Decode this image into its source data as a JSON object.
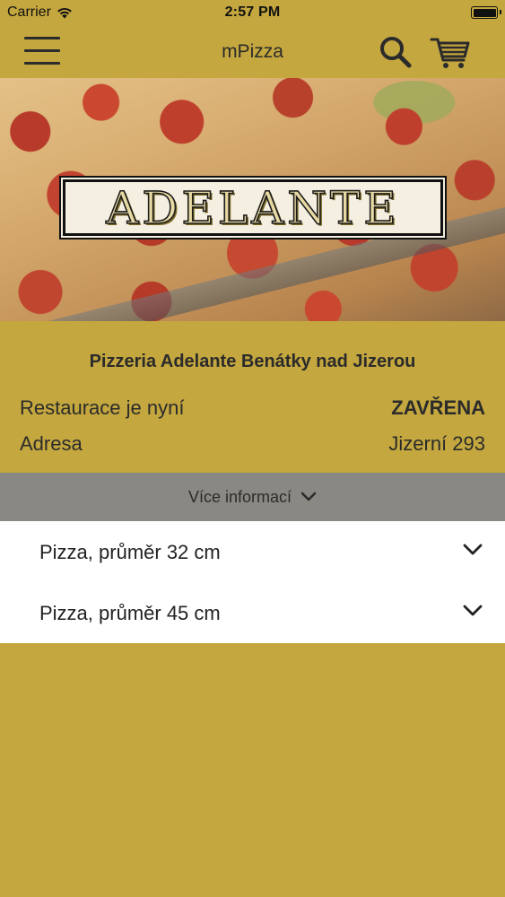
{
  "status_bar": {
    "carrier": "Carrier",
    "time": "2:57 PM",
    "wifi_icon": "wifi-icon",
    "battery_icon": "battery-icon"
  },
  "nav": {
    "title": "mPizza",
    "menu_icon": "hamburger-menu-icon",
    "search_icon": "search-icon",
    "cart_icon": "shopping-cart-icon"
  },
  "hero": {
    "logo_text": "ADELANTE"
  },
  "restaurant": {
    "name": "Pizzeria Adelante Benátky nad Jizerou",
    "status_label": "Restaurace je nyní",
    "status_value": "ZAVŘENA",
    "address_label": "Adresa",
    "address_value": "Jizerní 293"
  },
  "more_info": {
    "label": "Více informací",
    "icon": "chevron-down-icon"
  },
  "categories": [
    {
      "label": "Pizza, průměr 32 cm",
      "icon": "chevron-down-icon"
    },
    {
      "label": "Pizza, průměr 45 cm",
      "icon": "chevron-down-icon"
    }
  ],
  "colors": {
    "brand_gold": "#c4a73e",
    "more_bar_gray": "#8a8883",
    "text_dark": "#2b2b2b",
    "list_bg": "#ffffff"
  }
}
